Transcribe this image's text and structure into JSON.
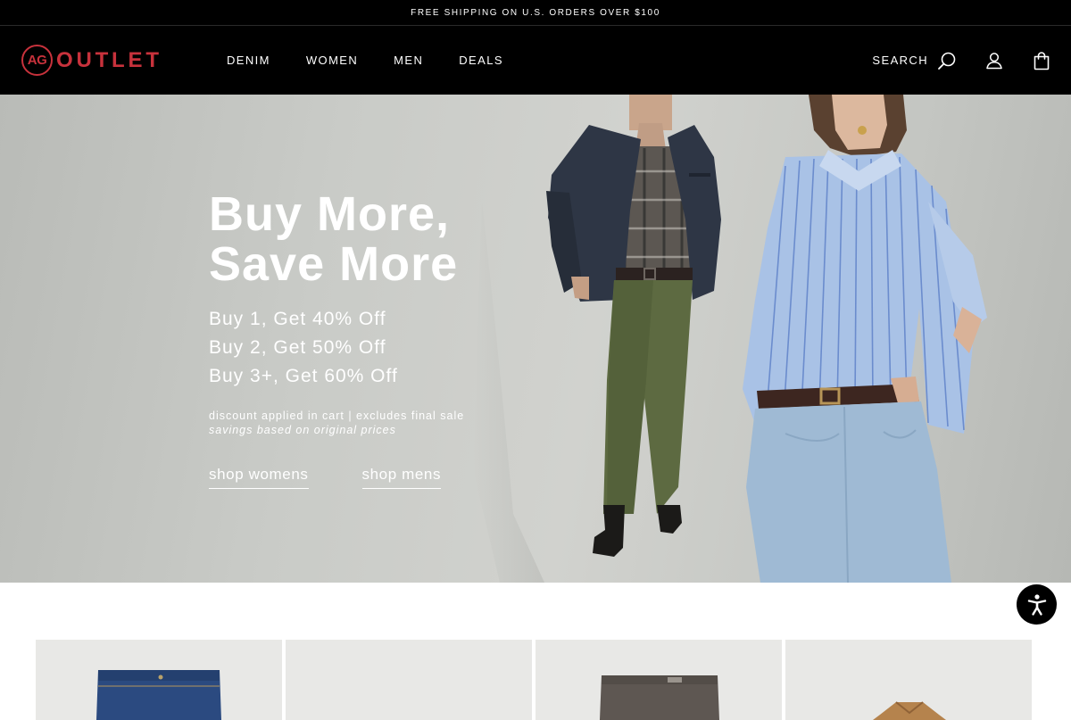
{
  "announcement": "FREE SHIPPING ON U.S. ORDERS OVER $100",
  "brand": {
    "logo_mark": "AG",
    "logo_word": "OUTLET",
    "accent_color": "#c8323c"
  },
  "nav": {
    "items": [
      {
        "label": "DENIM"
      },
      {
        "label": "WOMEN"
      },
      {
        "label": "MEN"
      },
      {
        "label": "DEALS"
      }
    ]
  },
  "utilities": {
    "search_label": "SEARCH",
    "icons": [
      "search-icon",
      "account-icon",
      "bag-icon"
    ]
  },
  "hero": {
    "title_line1": "Buy More,",
    "title_line2": "Save More",
    "offers": [
      "Buy 1, Get 40% Off",
      "Buy 2, Get 50% Off",
      "Buy 3+, Get 60% Off"
    ],
    "note": "discount applied in cart | excludes final sale",
    "note_italic": "savings based on original prices",
    "cta_womens": "shop womens",
    "cta_mens": "shop mens"
  },
  "accessibility": {
    "icon": "accessibility-icon"
  },
  "products": [
    {
      "icon": "jeans-image"
    },
    {
      "icon": "blank-image"
    },
    {
      "icon": "pants-image"
    },
    {
      "icon": "jacket-image"
    }
  ]
}
